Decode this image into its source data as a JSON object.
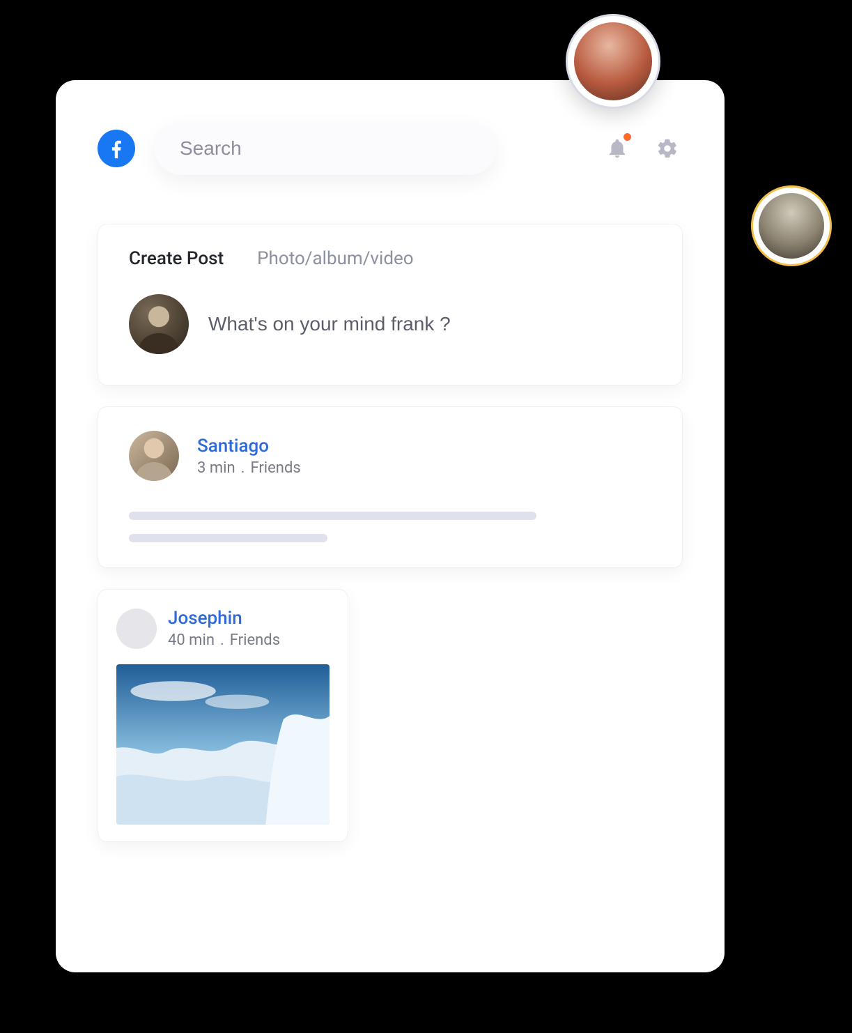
{
  "topbar": {
    "search_placeholder": "Search"
  },
  "create": {
    "tab_primary": "Create Post",
    "tab_secondary": "Photo/album/video",
    "input_placeholder": "What's on your mind frank ?"
  },
  "posts": [
    {
      "name": "Santiago",
      "time": "3 min",
      "audience": "Friends"
    },
    {
      "name": "Josephin",
      "time": "40 min",
      "audience": "Friends"
    }
  ]
}
